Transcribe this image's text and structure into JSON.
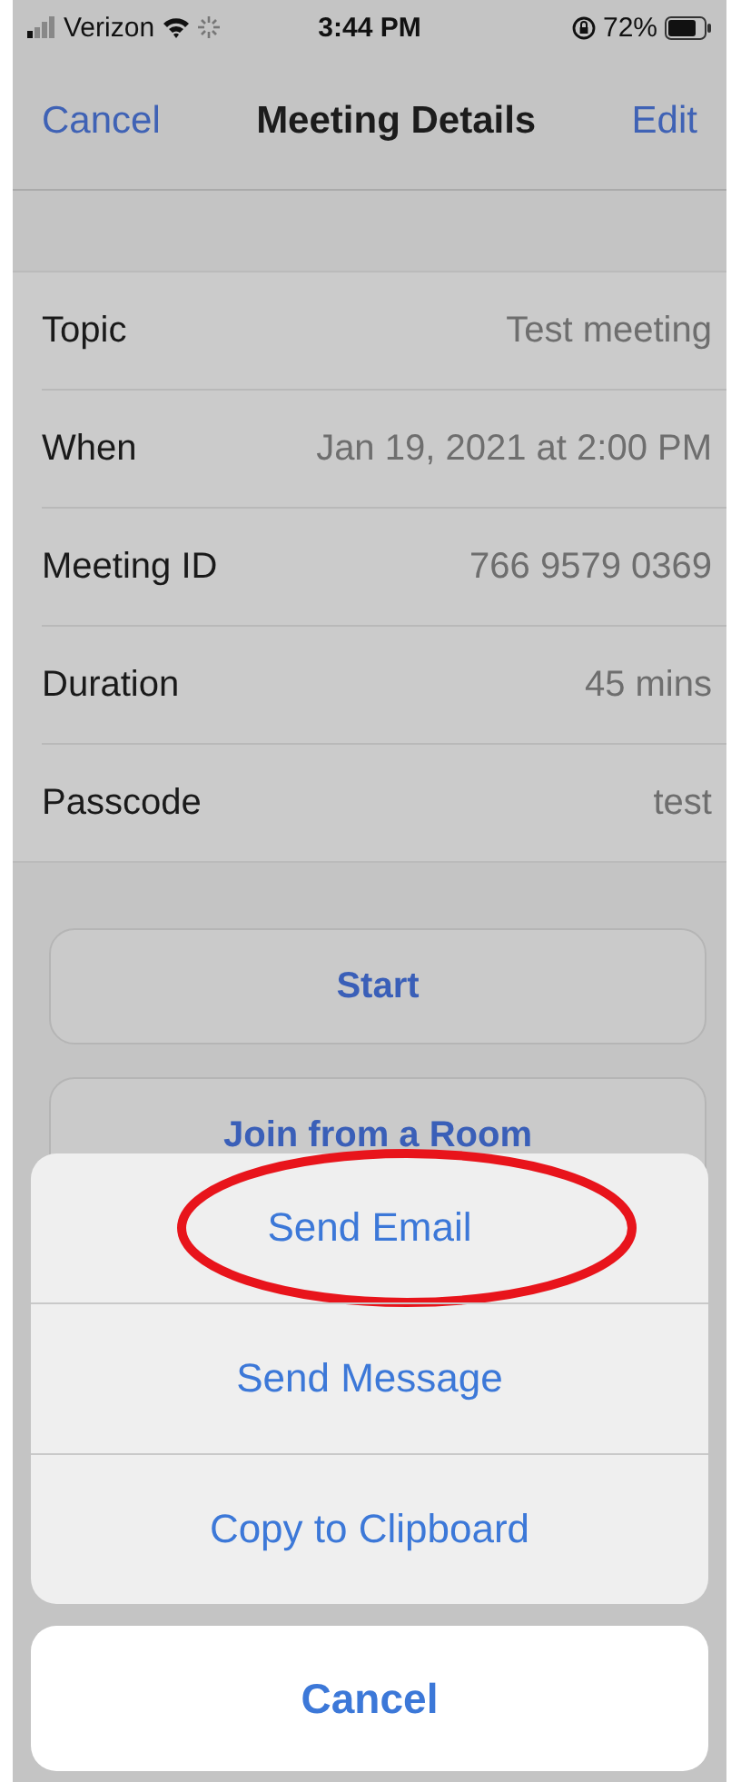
{
  "status_bar": {
    "carrier": "Verizon",
    "time": "3:44 PM",
    "battery": "72%"
  },
  "nav_bar": {
    "left": "Cancel",
    "title": "Meeting Details",
    "right": "Edit"
  },
  "details": [
    {
      "label": "Topic",
      "value": "Test meeting"
    },
    {
      "label": "When",
      "value": "Jan 19, 2021 at 2:00 PM"
    },
    {
      "label": "Meeting ID",
      "value": "766 9579 0369"
    },
    {
      "label": "Duration",
      "value": "45 mins"
    },
    {
      "label": "Passcode",
      "value": "test"
    }
  ],
  "buttons": [
    "Start",
    "Join from a Room"
  ],
  "action_sheet": {
    "actions": [
      {
        "label": "Send Email",
        "highlighted": true
      },
      {
        "label": "Send Message",
        "highlighted": false
      },
      {
        "label": "Copy to Clipboard",
        "highlighted": false
      }
    ],
    "cancel": "Cancel"
  }
}
